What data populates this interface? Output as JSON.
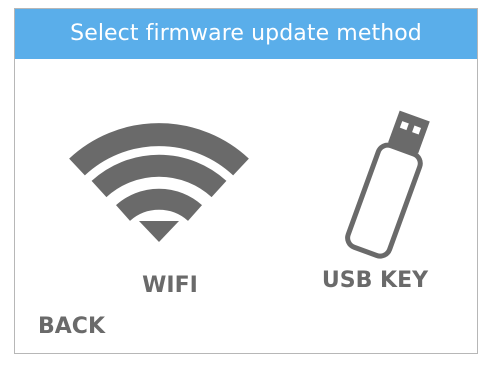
{
  "header": {
    "title": "Select firmware update method"
  },
  "options": {
    "wifi": {
      "label": "WIFI",
      "icon": "wifi-icon"
    },
    "usb": {
      "label": "USB KEY",
      "icon": "usb-key-icon"
    }
  },
  "footer": {
    "back_label": "BACK"
  },
  "colors": {
    "header_background": "#5aaeea",
    "header_text": "#ffffff",
    "icon_gray": "#6a6a6a",
    "label_gray": "#6a6a6a",
    "border": "#b7b7b7"
  }
}
